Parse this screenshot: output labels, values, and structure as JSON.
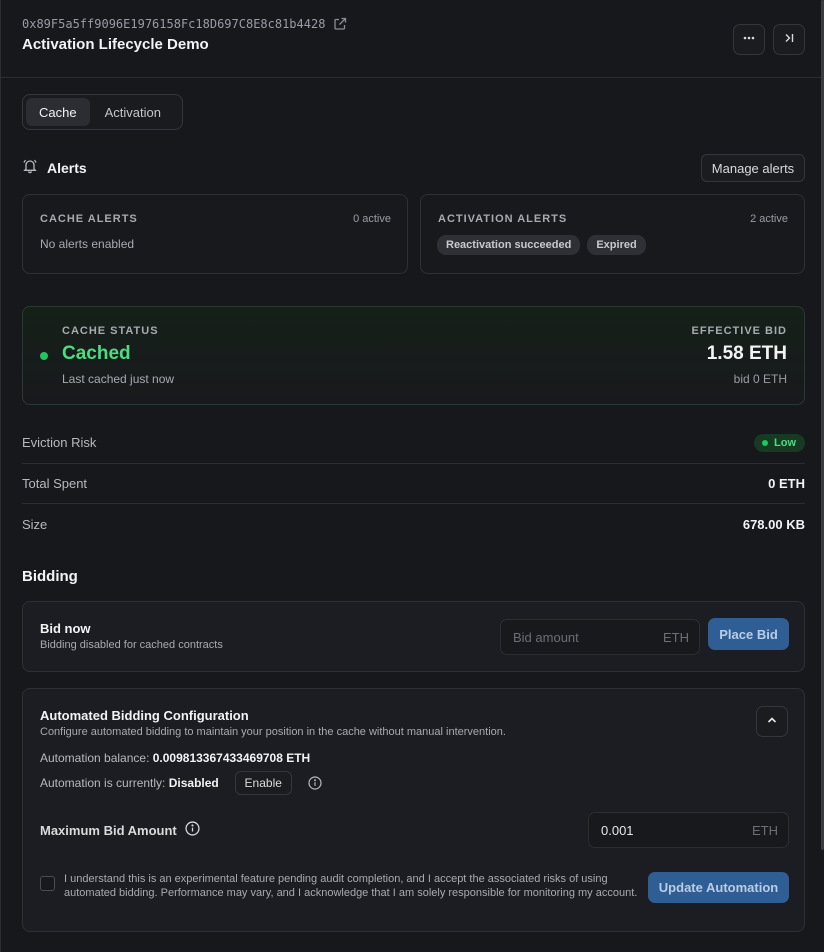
{
  "header": {
    "address": "0x89F5a5ff9096E1976158Fc18D697C8E8c81b4428",
    "title": "Activation Lifecycle Demo"
  },
  "tabs": [
    {
      "label": "Cache",
      "active": true
    },
    {
      "label": "Activation",
      "active": false
    }
  ],
  "alerts": {
    "title": "Alerts",
    "manage_label": "Manage alerts",
    "cache": {
      "label": "CACHE ALERTS",
      "count": "0 active",
      "empty_text": "No alerts enabled"
    },
    "activation": {
      "label": "ACTIVATION ALERTS",
      "count": "2 active",
      "chips": [
        "Reactivation succeeded",
        "Expired"
      ]
    }
  },
  "cache_status": {
    "label": "CACHE STATUS",
    "value": "Cached",
    "sub": "Last cached just now",
    "bid_label": "EFFECTIVE BID",
    "bid_value": "1.58 ETH",
    "bid_sub": "bid 0 ETH",
    "status_color": "#4ade80"
  },
  "info": {
    "eviction_label": "Eviction Risk",
    "eviction_value": "Low",
    "spent_label": "Total Spent",
    "spent_value": "0 ETH",
    "size_label": "Size",
    "size_value": "678.00 KB"
  },
  "bidding": {
    "title": "Bidding",
    "bid_now_title": "Bid now",
    "bid_now_sub": "Bidding disabled for cached contracts",
    "bid_placeholder": "Bid amount",
    "bid_unit": "ETH",
    "place_label": "Place Bid",
    "accent": "#2f5e95"
  },
  "automation": {
    "title": "Automated Bidding Configuration",
    "sub": "Configure automated bidding to maintain your position in the cache without manual intervention.",
    "balance_label": "Automation balance: ",
    "balance_value": "0.009813367433469708 ETH",
    "state_label": "Automation is currently: ",
    "state_value": "Disabled",
    "enable_label": "Enable",
    "max_label": "Maximum Bid Amount",
    "max_value": "0.001",
    "max_unit": "ETH",
    "consent": "I understand this is an experimental feature pending audit completion, and I accept the associated risks of using automated bidding. Performance may vary, and I acknowledge that I am solely responsible for monitoring my account.",
    "update_label": "Update Automation"
  },
  "icons": {
    "external": "external-link-icon",
    "more": "more-horizontal-icon",
    "panel_close": "panel-collapse-icon",
    "bell": "bell-icon",
    "chevron": "chevron-up-icon",
    "info": "info-icon"
  }
}
